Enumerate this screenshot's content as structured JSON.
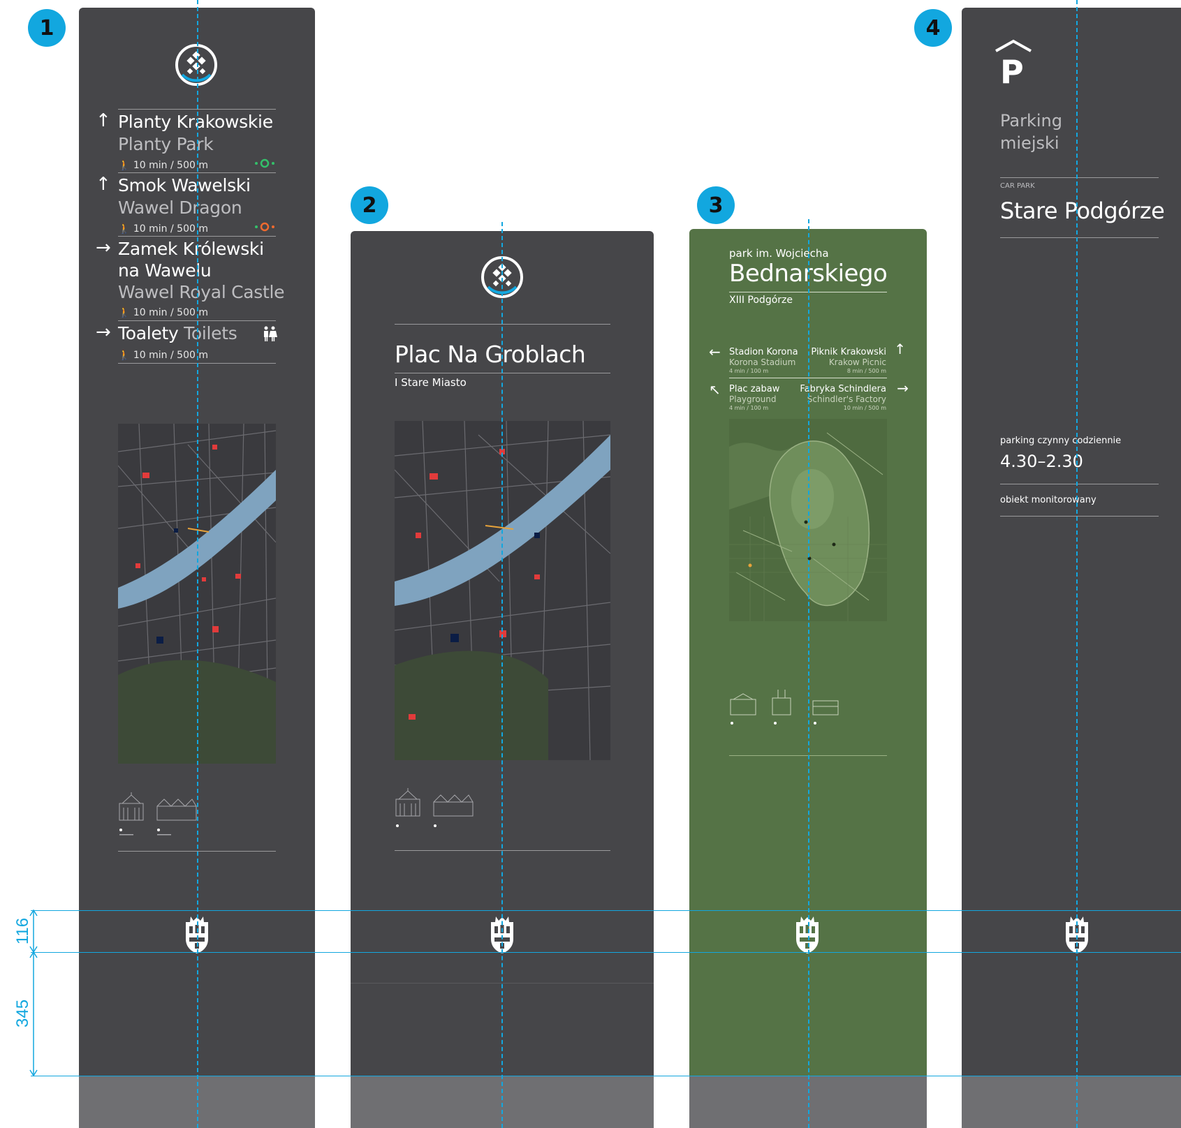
{
  "colors": {
    "accent": "#12a7df",
    "panel_dark": "#464649",
    "panel_green": "#557346",
    "base_grey": "#6f6f72",
    "river": "#7fa3bf"
  },
  "badges": [
    "1",
    "2",
    "3",
    "4"
  ],
  "dimensions": {
    "upper": "116",
    "lower": "345"
  },
  "sign1": {
    "destinations": [
      {
        "arrow": "↑",
        "name": "Planty Krakowskie",
        "english": "Planty Park",
        "time": "10 min / 500 m",
        "icon": "route-green-icon"
      },
      {
        "arrow": "↑",
        "name": "Smok Wawelski",
        "english": "Wawel Dragon",
        "time": "10 min / 500 m",
        "icon": "route-orange-icon"
      },
      {
        "arrow": "→",
        "name_line1": "Zamek Królewski",
        "name_line2": "na Wawelu",
        "english": "Wawel Royal Castle",
        "time": "10 min / 500 m"
      },
      {
        "arrow": "→",
        "name": "Toalety",
        "english": "Toilets",
        "time": "10 min / 500 m",
        "icon": "toilets-icon"
      }
    ]
  },
  "sign2": {
    "title": "Plac Na Groblach",
    "subtitle": "I Stare Miasto"
  },
  "sign3": {
    "prefix": "park im. Wojciecha",
    "title": "Bednarskiego",
    "subtitle": "XIII Podgórze",
    "left": [
      {
        "arrow": "←",
        "name": "Stadion Korona",
        "english": "Korona Stadium",
        "time": "4 min / 100 m"
      },
      {
        "arrow": "↖",
        "name": "Plac zabaw",
        "english": "Playground",
        "time": "4 min / 100 m"
      }
    ],
    "right": [
      {
        "arrow": "↑",
        "name": "Piknik Krakowski",
        "english": "Krakow Picnic",
        "time": "8 min / 500 m"
      },
      {
        "arrow": "→",
        "name": "Fabryka Schindlera",
        "english": "Schindler's Factory",
        "time": "10 min / 500 m"
      }
    ]
  },
  "sign4": {
    "icon_letter": "P",
    "title_line1": "Parking",
    "title_line2": "miejski",
    "label": "CAR PARK",
    "name": "Stare Podgórze",
    "hours_label": "parking czynny codziennie",
    "hours": "4.30–2.30",
    "note": "obiekt monitorowany"
  }
}
